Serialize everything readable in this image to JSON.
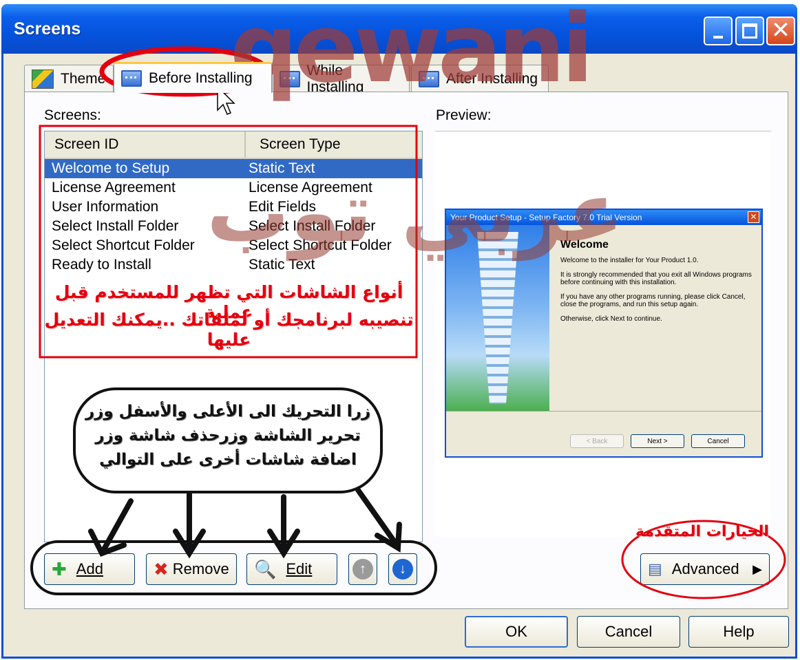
{
  "window": {
    "title": "Screens"
  },
  "tabs": [
    {
      "label": "Theme"
    },
    {
      "label": "Before Installing"
    },
    {
      "label": "While Installing"
    },
    {
      "label": "After Installing"
    }
  ],
  "screens_label": "Screens:",
  "preview_label": "Preview:",
  "list": {
    "headers": [
      "Screen ID",
      "Screen Type"
    ],
    "rows": [
      {
        "id": "Welcome to Setup",
        "type": "Static Text"
      },
      {
        "id": "License Agreement",
        "type": "License Agreement"
      },
      {
        "id": "User Information",
        "type": "Edit Fields"
      },
      {
        "id": "Select Install Folder",
        "type": "Select Install Folder"
      },
      {
        "id": "Select Shortcut Folder",
        "type": "Select Shortcut Folder"
      },
      {
        "id": "Ready to Install",
        "type": "Static Text"
      }
    ]
  },
  "preview": {
    "title": "Your Product Setup - Setup Factory 7.0 Trial Version",
    "heading": "Welcome",
    "p1": "Welcome to the installer for Your Product 1.0.",
    "p2": "It is strongly recommended that you exit all Windows programs before continuing with this installation.",
    "p3": "If you have any other programs running, please click Cancel, close the programs, and run this setup again.",
    "p4": "Otherwise, click Next to continue.",
    "back": "< Back",
    "next": "Next >",
    "cancel": "Cancel"
  },
  "buttons": {
    "add": "Add",
    "remove": "Remove",
    "edit": "Edit",
    "advanced": "Advanced",
    "ok": "OK",
    "cancel": "Cancel",
    "help": "Help"
  },
  "annotations": {
    "screens_types_line1": "أنواع الشاشات التي تظهر للمستخدم قبل عملية",
    "screens_types_line2": "تنصيبه لبرنامجك أو لملفاتك ..يمكنك التعديل عليها",
    "buttons_line1": "زرا التحريك الى الأعلى والأسفل وزر",
    "buttons_line2": "تحرير الشاشة وزرحذف شاشة وزر",
    "buttons_line3": "اضافة شاشات أخرى على التوالي",
    "advanced_options": "الخيارات المتقدمة",
    "watermark_latin": "qewani",
    "watermark_arabic": "عربي توب"
  },
  "colors": {
    "annotation_red": "#e3000f",
    "selection_blue": "#316ac5",
    "titlebar_blue": "#0553dd"
  }
}
